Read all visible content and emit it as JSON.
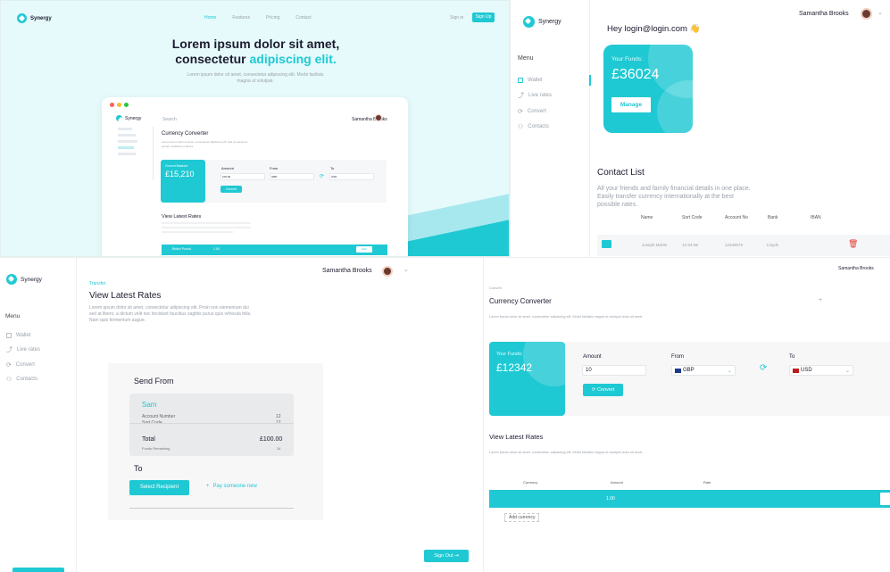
{
  "landing": {
    "brand": "Synergy",
    "nav": [
      "Home",
      "Features",
      "Pricing",
      "Contact"
    ],
    "sign_in": "Sign in",
    "sign_up": "Sign Up",
    "hero_line1": "Lorem ipsum dolor sit amet,",
    "hero_line2a": "consectetur ",
    "hero_line2b": "adipiscing elit.",
    "hero_sub": "Lorem ipsum dolor sit amet, consectetur adipiscing elit. Morbi facilisis magna ut volutpat.",
    "mock": {
      "brand": "Synergy",
      "search": "Search",
      "user": "Samantha Brooks",
      "title": "Currency Converter",
      "desc": "Lorem ipsum dolor sit amet, consectetur adipiscing elit. Sed do eiusmod tempor incididunt ut labore.",
      "funds_label": "Current Balance",
      "funds_value": "£15,210",
      "amount_label": "Amount",
      "from_label": "From",
      "to_label": "To",
      "amount_value": "100.00",
      "from_value": "GBP",
      "to_value": "USD",
      "convert": "Convert",
      "rates_title": "View Latest Rates",
      "row_currency": "British Pound",
      "row_amount": "1.00",
      "row_btn": "Edit"
    }
  },
  "wallet": {
    "brand": "Synergy",
    "user": "Samantha Brooks",
    "greeting": "Hey login@login.com",
    "wave": "👋",
    "menu_title": "Menu",
    "menu": [
      "Wallet",
      "Live rates",
      "Convert",
      "Contacts"
    ],
    "funds_label": "Your Funds:",
    "funds_value": "£36024",
    "manage": "Manage",
    "contact_title": "Contact List",
    "contact_desc": "All your friends and family financial details in one place. Easily transfer currency internationally at the best possible rates.",
    "columns": [
      "Name",
      "Sort Code",
      "Account No",
      "Bank",
      "IBAN"
    ],
    "row": {
      "name": "Joseph Martin",
      "sort": "12-34-56",
      "acct": "12345678",
      "bank": "Lloyds",
      "iban": ""
    }
  },
  "transfer": {
    "brand": "Synergy",
    "user": "Samantha Brooks",
    "menu_title": "Menu",
    "menu": [
      "Wallet",
      "Live rates",
      "Convert",
      "Contacts"
    ],
    "crumb": "Transfer",
    "title": "View Latest Rates",
    "desc": "Lorem ipsum dolor sit amet, consectetur adipiscing elit. Proin non elementum dui sed at libero, a dictum velit nec tincidunt faucibus sagittis purus quis vehicula felis. Nam quis fermentum augue.",
    "send_from": "Send From",
    "acct_name": "Sam",
    "acct_number_label": "Account Number",
    "acct_number_val": "12",
    "sort_label": "Sort Code",
    "sort_val": "12",
    "total_label": "Total",
    "total_val": "£100.00",
    "funds_remaining_label": "Funds Remaining",
    "funds_remaining_val": "34",
    "to_label": "To",
    "select_recipient": "Select Recipient",
    "pay_new": "Pay someone new",
    "sign_out": "Sign Out"
  },
  "converter": {
    "user": "Samantha Brooks",
    "crumb": "Convert",
    "title": "Currency Converter",
    "desc": "Lorem ipsum dolor sit amet, consectetur adipiscing elit. Morbi facilisis magna ut volutpat dolor sit amet.",
    "funds_label": "Your Funds:",
    "funds_value": "£12342",
    "amount_label": "Amount",
    "from_label": "From",
    "to_label": "To",
    "amount_value": "10",
    "from_value": "GBP",
    "to_value": "USD",
    "convert": "Convert",
    "rates_title": "View Latest Rates",
    "rates_desc": "Lorem ipsum dolor sit amet, consectetur adipiscing elit. Morbi facilisis magna ut volutpat dolor sit amet.",
    "columns": [
      "Currency",
      "Amount",
      "Rate"
    ],
    "row_amount": "1.00",
    "add_currency": "Add currency"
  }
}
